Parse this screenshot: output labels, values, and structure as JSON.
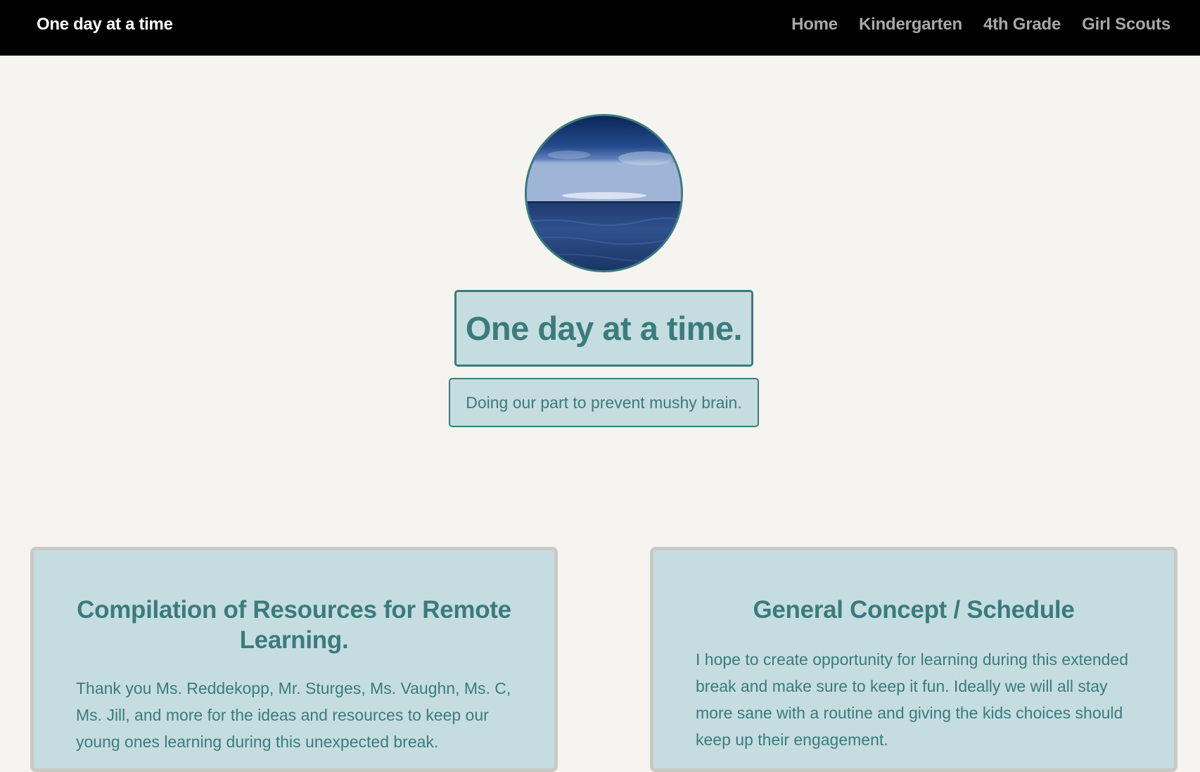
{
  "navbar": {
    "brand": "One day at a time",
    "links": [
      "Home",
      "Kindergarten",
      "4th Grade",
      "Girl Scouts"
    ]
  },
  "hero": {
    "avatar_image": "ocean-horizon-image",
    "title": "One day at a time.",
    "subtitle": "Doing our part to prevent mushy brain."
  },
  "cards": [
    {
      "heading": "Compilation of Resources for Remote Learning.",
      "body": "Thank you Ms. Reddekopp, Mr. Sturges, Ms. Vaughn, Ms. C, Ms. Jill, and more for the ideas and resources to keep our young ones learning during this unexpected break."
    },
    {
      "heading": "General Concept / Schedule",
      "body": "I hope to create opportunity for learning during this extended break and make sure to keep it fun. Ideally we will all stay more sane with a routine and giving the kids choices should keep up their engagement."
    }
  ],
  "colors": {
    "accent": "#3b7b7c",
    "panel": "#c5dde0",
    "background": "#f5f4f0",
    "navbar": "#000000"
  }
}
